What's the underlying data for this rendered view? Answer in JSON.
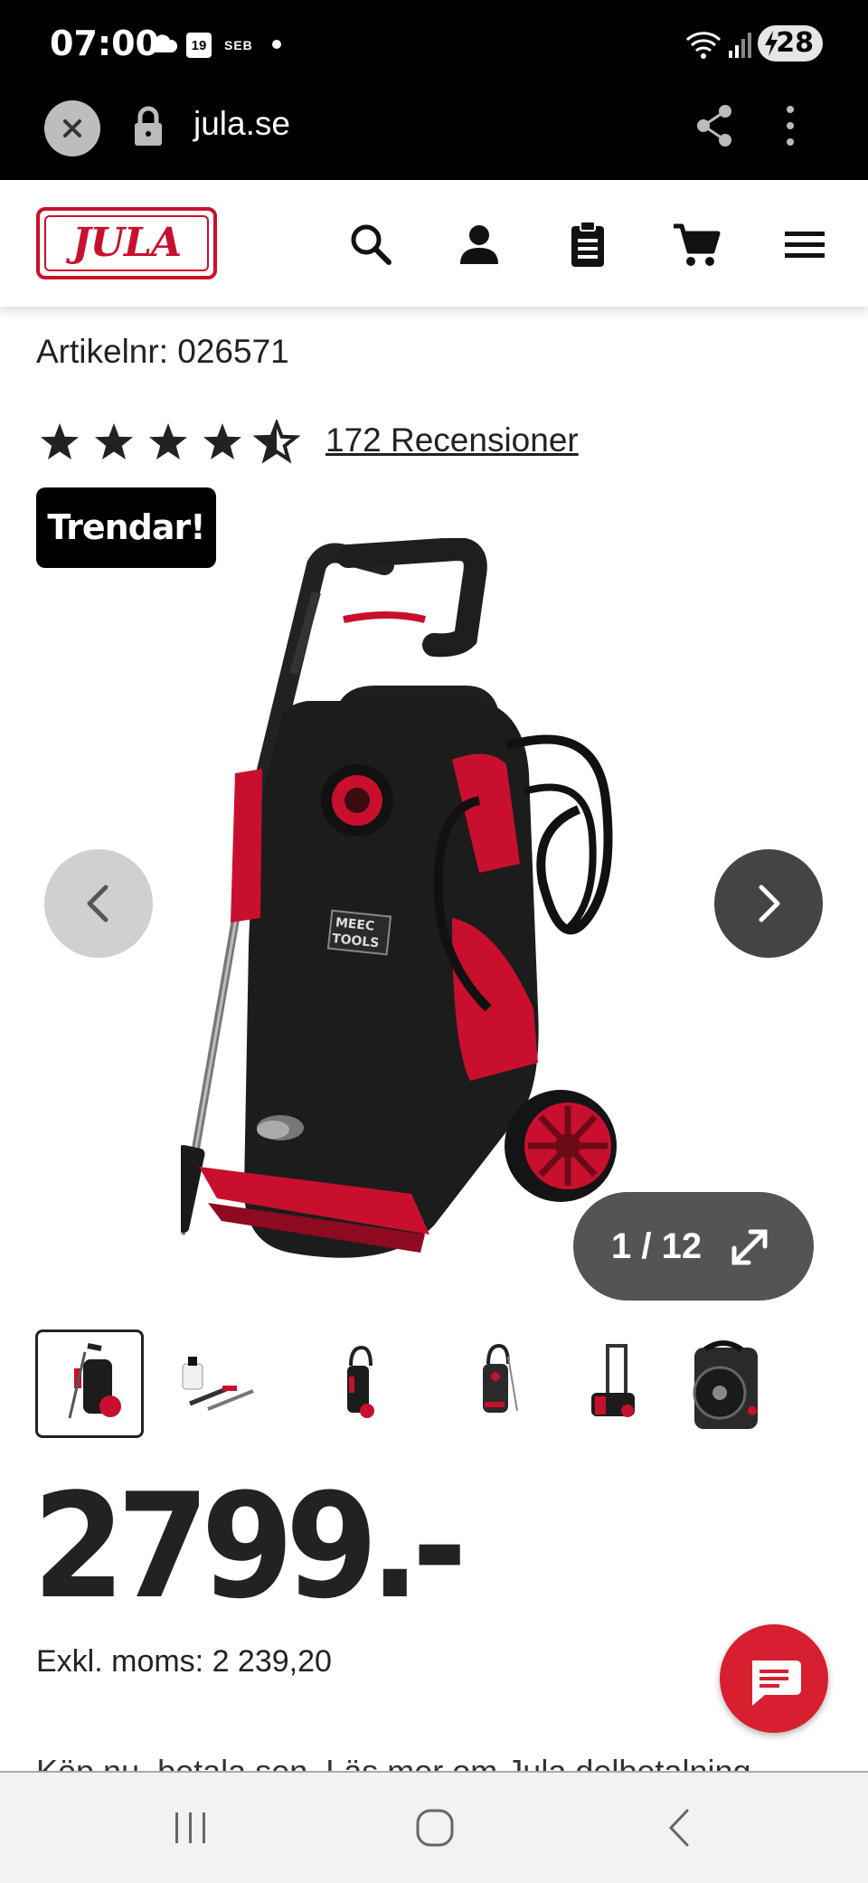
{
  "status_bar": {
    "time": "07:00",
    "calendar_day": "19",
    "bank": "SEB",
    "battery": "28"
  },
  "browser": {
    "url": "jula.se"
  },
  "site": {
    "logo": "JULA"
  },
  "product": {
    "article_number": "Artikelnr: 026571",
    "rating": 4.5,
    "rating_max": 5,
    "reviews": "172 Recensioner",
    "badge": "Trendar!",
    "brand_on_product": "MEEC TOOLS",
    "image_counter": "1 / 12",
    "thumbnail_count": 6,
    "price": "2799.-",
    "price_ex_vat": "Exkl. moms: 2 239,20",
    "payment_note": "Köp nu, betala sen. Läs mer om Jula delbetalning"
  },
  "colors": {
    "brand_red": "#c8102e",
    "chat_red": "#d71f2f"
  }
}
